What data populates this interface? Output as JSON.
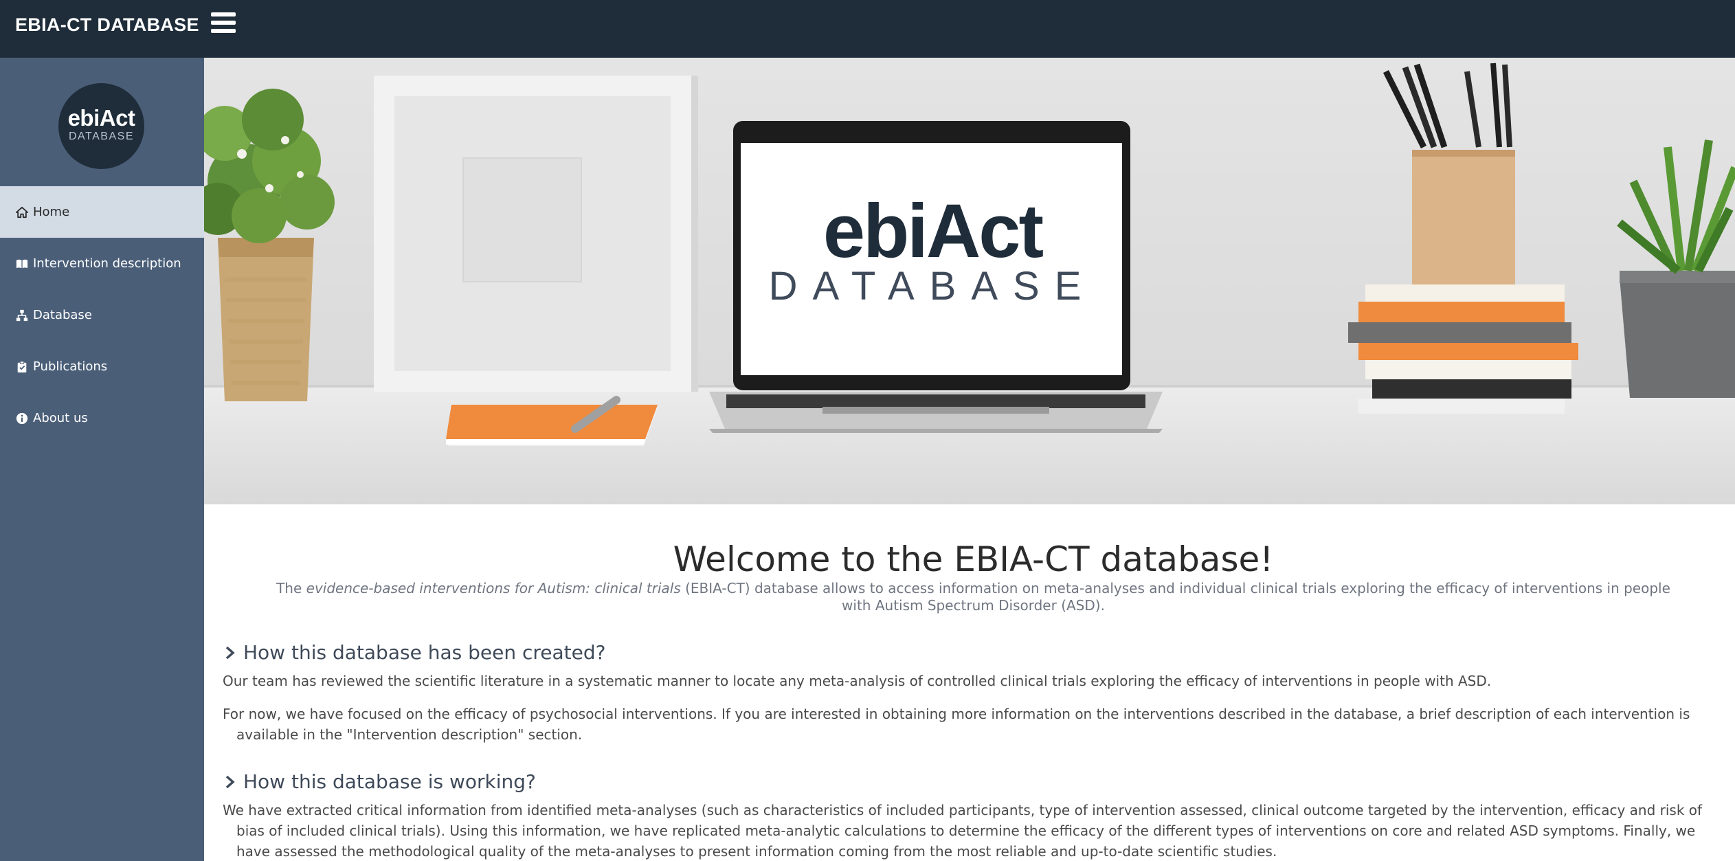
{
  "app": {
    "brand": "EBIA-CT DATABASE"
  },
  "logo": {
    "main": "ebiAct",
    "sub": "DATABASE"
  },
  "sidebar": {
    "items": [
      {
        "label": "Home",
        "icon": "home-icon",
        "active": true
      },
      {
        "label": "Intervention description",
        "icon": "book-icon",
        "active": false
      },
      {
        "label": "Database",
        "icon": "sitemap-icon",
        "active": false
      },
      {
        "label": "Publications",
        "icon": "clipboard-icon",
        "active": false
      },
      {
        "label": "About us",
        "icon": "info-icon",
        "active": false
      }
    ]
  },
  "hero": {
    "screen_main": "ebiAct",
    "screen_sub": "DATABASE"
  },
  "main": {
    "title": "Welcome to the EBIA-CT database!",
    "intro_prefix": "The ",
    "intro_italic": "evidence-based interventions for Autism: clinical trials",
    "intro_suffix": " (EBIA-CT) database allows to access information on meta-analyses and individual clinical trials exploring the efficacy of interventions in people with Autism Spectrum Disorder (ASD).",
    "sections": [
      {
        "heading": "How this database has been created?",
        "paragraphs": [
          "Our team has reviewed the scientific literature in a systematic manner to locate any meta-analysis of controlled clinical trials exploring the efficacy of interventions in people with ASD.",
          "For now, we have focused on the efficacy of psychosocial interventions. If you are interested in obtaining more information on the interventions described in the database, a brief description of each intervention is available in the \"Intervention description\" section."
        ]
      },
      {
        "heading": "How this database is working?",
        "paragraphs": [
          "We have extracted critical information from identified meta-analyses (such as characteristics of included participants, type of intervention assessed, clinical outcome targeted by the intervention, efficacy and risk of bias of included clinical trials). Using this information, we have replicated meta-analytic calculations to determine the efficacy of the different types of interventions on core and related ASD symptoms. Finally, we have assessed the methodological quality of the meta-analyses to present information coming from the most reliable and up-to-date scientific studies."
        ]
      }
    ]
  },
  "colors": {
    "navbar": "#1f2d3a",
    "sidebar": "#4a5e78",
    "active_item": "#d3dbe5"
  }
}
